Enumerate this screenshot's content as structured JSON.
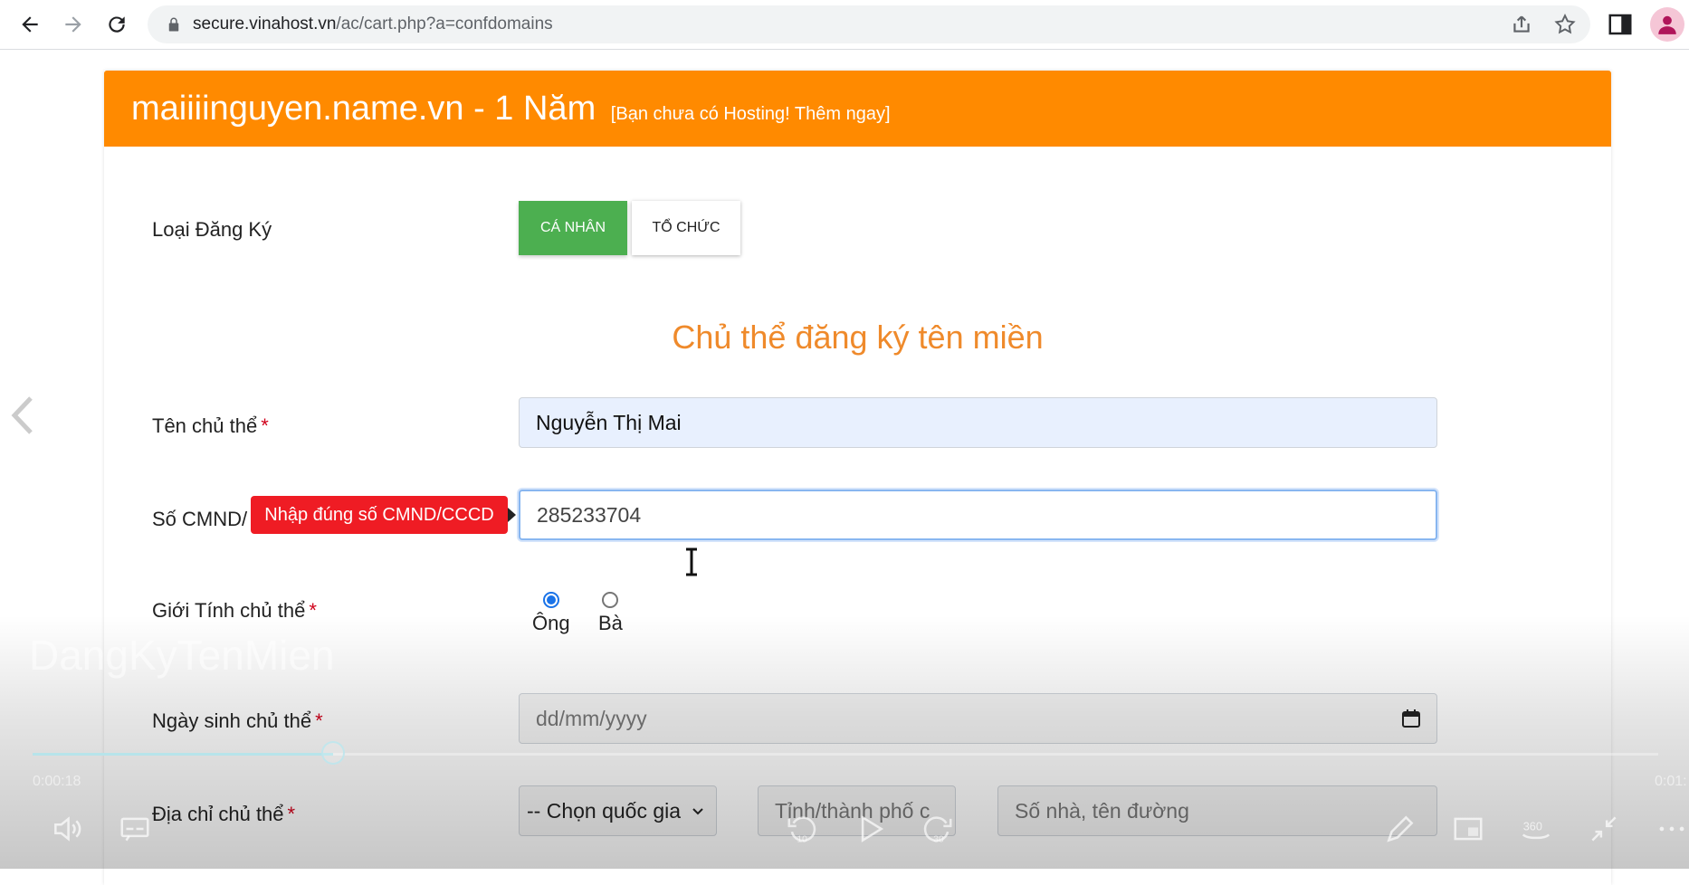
{
  "browser": {
    "url_host": "secure.vinahost.vn",
    "url_path": "/ac/cart.php?a=confdomains"
  },
  "header": {
    "domain_title": "maiiiinguyen.name.vn - 1 Năm",
    "hosting_link": "[Bạn chưa có Hosting! Thêm ngay]"
  },
  "form": {
    "registration_type_label": "Loại Đăng Ký",
    "btn_individual": "CÁ NHÂN",
    "btn_organization": "TỔ CHỨC",
    "section_title": "Chủ thể đăng ký tên miền",
    "owner_name_label": "Tên chủ thể",
    "owner_name_value": "Nguyễn Thị Mai",
    "id_label": "Số CMND/",
    "id_value": "285233704",
    "id_tooltip": "Nhập đúng số CMND/CCCD",
    "gender_label": "Giới Tính chủ thể",
    "gender_options": [
      "Ông",
      "Bà"
    ],
    "gender_selected": "Ông",
    "dob_label": "Ngày sinh chủ thể",
    "dob_placeholder": "dd/mm/yyyy",
    "address_label": "Địa chỉ chủ thể",
    "country_select": "-- Chọn quốc gia",
    "city_placeholder": "Tỉnh/thành phố c",
    "street_placeholder": "Số nhà, tên đường",
    "required_mark": "*"
  },
  "video": {
    "title": "DangKyTenMien",
    "current_time": "0:00:18",
    "end_time": "0:01:",
    "progress": 0.185,
    "skip_back_seconds": "10",
    "skip_forward_seconds": "30",
    "view_mode": "360"
  },
  "colors": {
    "header_orange": "#ff8a00",
    "section_title": "#ef8a2b",
    "button_green": "#4caf50",
    "tooltip_red": "#ef1c24",
    "required_red": "#d0021b"
  }
}
